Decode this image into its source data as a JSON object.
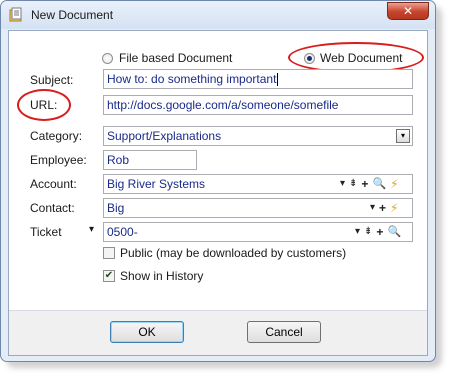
{
  "window": {
    "title": "New Document",
    "close_glyph": "✕"
  },
  "doc_type": {
    "file_label": "File based Document",
    "web_label": "Web Document",
    "selected": "web"
  },
  "form": {
    "subject_label": "Subject:",
    "subject_value": "How to: do something important",
    "url_label": "URL:",
    "url_value": "http://docs.google.com/a/someone/somefile",
    "category_label": "Category:",
    "category_value": "Support/Explanations",
    "employee_label": "Employee:",
    "employee_value": "Rob",
    "account_label": "Account:",
    "account_value": "Big River Systems",
    "contact_label": "Contact:",
    "contact_value": "Big",
    "ticket_label": "Ticket",
    "ticket_value": "0500-",
    "public_label": "Public (may be downloaded by customers)",
    "public_checked": false,
    "history_label": "Show in History",
    "history_checked": true
  },
  "icons": {
    "dropdown": "▾",
    "filter": "⇟",
    "add": "+",
    "search": "🔍",
    "bolt": "⚡",
    "check": "✔"
  },
  "buttons": {
    "ok_label": "OK",
    "cancel_label": "Cancel"
  },
  "colors": {
    "annotation": "#d91c1c",
    "field_text": "#1a2a8a",
    "title_bar": "#d5e2f3"
  }
}
